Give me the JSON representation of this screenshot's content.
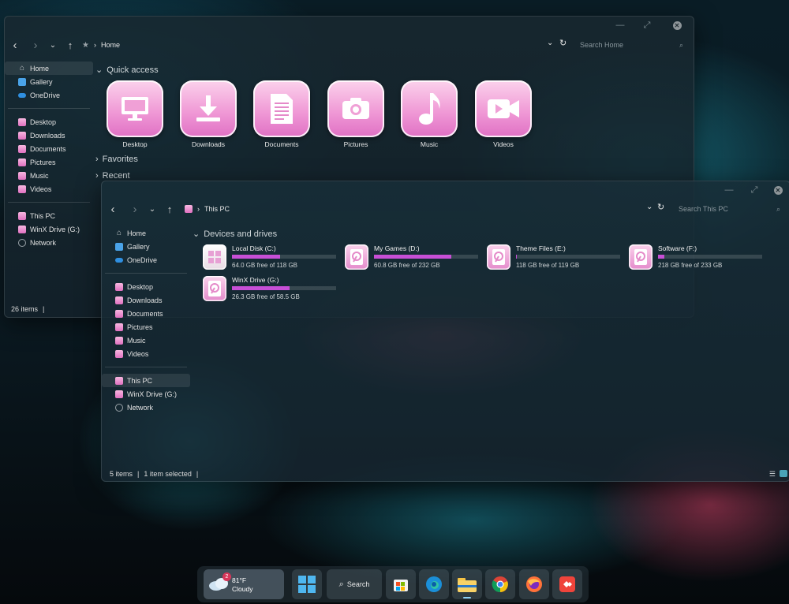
{
  "window_back": {
    "breadcrumb": "Home",
    "search_placeholder": "Search Home",
    "sidebar_top": [
      {
        "label": "Home",
        "icon": "home-icon"
      },
      {
        "label": "Gallery",
        "icon": "gallery-icon"
      },
      {
        "label": "OneDrive",
        "icon": "onedrive-icon"
      }
    ],
    "sidebar_folders": [
      "Desktop",
      "Downloads",
      "Documents",
      "Pictures",
      "Music",
      "Videos"
    ],
    "sidebar_drives": [
      "This PC",
      "WinX Drive (G:)",
      "Network"
    ],
    "sections": {
      "quick_access": "Quick access",
      "favorites": "Favorites",
      "recent": "Recent"
    },
    "quick_access": [
      {
        "label": "Desktop",
        "icon": "monitor-icon"
      },
      {
        "label": "Downloads",
        "icon": "download-icon"
      },
      {
        "label": "Documents",
        "icon": "document-icon"
      },
      {
        "label": "Pictures",
        "icon": "camera-icon"
      },
      {
        "label": "Music",
        "icon": "music-note-icon"
      },
      {
        "label": "Videos",
        "icon": "video-camera-icon"
      }
    ],
    "status": "26 items"
  },
  "window_front": {
    "breadcrumb": "This PC",
    "search_placeholder": "Search This PC",
    "sidebar_top": [
      {
        "label": "Home",
        "icon": "home-icon"
      },
      {
        "label": "Gallery",
        "icon": "gallery-icon"
      },
      {
        "label": "OneDrive",
        "icon": "onedrive-icon"
      }
    ],
    "sidebar_folders": [
      "Desktop",
      "Downloads",
      "Documents",
      "Pictures",
      "Music",
      "Videos"
    ],
    "sidebar_drives": [
      "This PC",
      "WinX Drive (G:)",
      "Network"
    ],
    "section": "Devices and drives",
    "drives": [
      {
        "name": "Local Disk (C:)",
        "free": "64.0 GB free of 118 GB",
        "used_fraction": 0.46,
        "icon": "windows-drive-icon"
      },
      {
        "name": "My Games (D:)",
        "free": "60.8 GB free of 232 GB",
        "used_fraction": 0.74,
        "icon": "hard-drive-icon"
      },
      {
        "name": "Theme Files (E:)",
        "free": "118 GB free of 119 GB",
        "used_fraction": 0.01,
        "icon": "hard-drive-icon"
      },
      {
        "name": "Software (F:)",
        "free": "218 GB free of 233 GB",
        "used_fraction": 0.06,
        "icon": "hard-drive-icon"
      },
      {
        "name": "WinX Drive (G:)",
        "free": "26.3 GB free of 58.5 GB",
        "used_fraction": 0.55,
        "icon": "hard-drive-icon"
      }
    ],
    "status_items": "5 items",
    "status_selected": "1 item selected"
  },
  "taskbar": {
    "weather_temp": "81°F",
    "weather_desc": "Cloudy",
    "weather_badge": "2",
    "search_label": "Search",
    "apps": [
      "start-icon",
      "search",
      "store-icon",
      "edge-icon",
      "file-explorer-icon",
      "chrome-icon",
      "firefox-icon",
      "anydesk-icon"
    ]
  },
  "colors": {
    "accent_pink": "#f09ad6",
    "bar_fill": "#c74fd6"
  }
}
